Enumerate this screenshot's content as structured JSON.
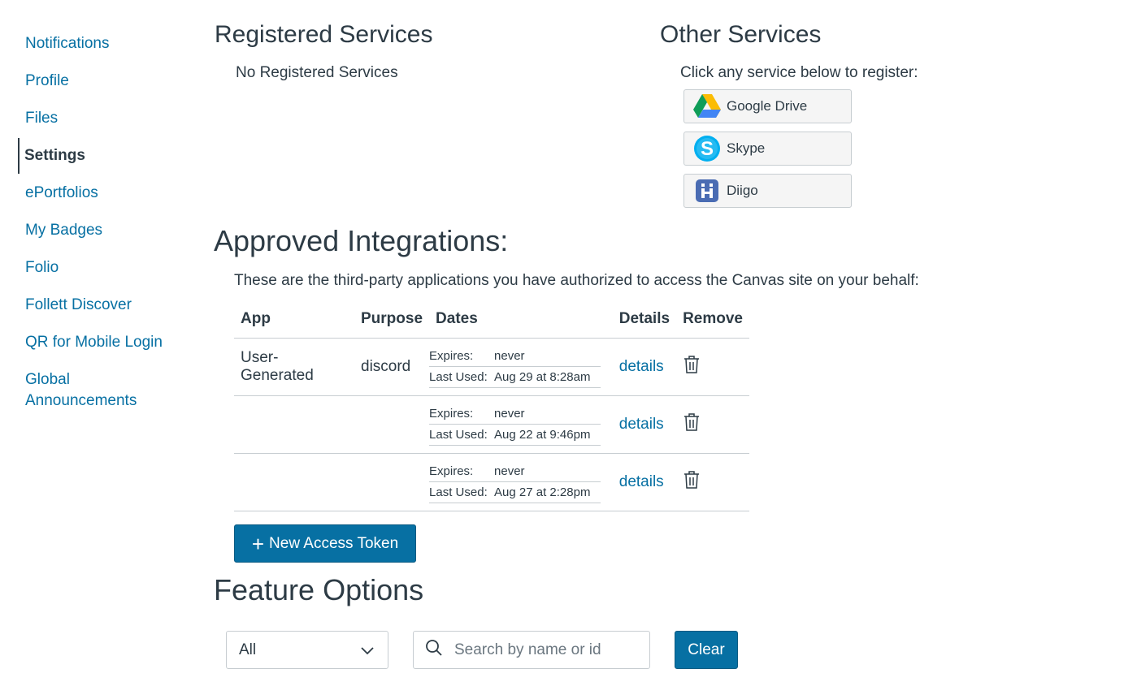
{
  "sidebar": {
    "items": [
      {
        "label": "Notifications"
      },
      {
        "label": "Profile"
      },
      {
        "label": "Files"
      },
      {
        "label": "Settings"
      },
      {
        "label": "ePortfolios"
      },
      {
        "label": "My Badges"
      },
      {
        "label": "Folio"
      },
      {
        "label": "Follett Discover"
      },
      {
        "label": "QR for Mobile Login"
      },
      {
        "label": "Global Announcements"
      }
    ],
    "active": "Settings"
  },
  "registered_services": {
    "title": "Registered Services",
    "empty_text": "No Registered Services"
  },
  "other_services": {
    "title": "Other Services",
    "prompt": "Click any service below to register:",
    "services": [
      {
        "label": "Google Drive",
        "icon": "google-drive-icon"
      },
      {
        "label": "Skype",
        "icon": "skype-icon"
      },
      {
        "label": "Diigo",
        "icon": "diigo-icon"
      }
    ]
  },
  "integrations": {
    "title": "Approved Integrations:",
    "description": "These are the third-party applications you have authorized to access the Canvas site on your behalf:",
    "columns": [
      "App",
      "Purpose",
      "Dates",
      "Details",
      "Remove"
    ],
    "rows": [
      {
        "app": "User-Generated",
        "purpose": "discord",
        "expires_label": "Expires:",
        "expires": "never",
        "last_used_label": "Last Used:",
        "last_used": "Aug 29 at 8:28am",
        "details": "details"
      },
      {
        "app": "",
        "purpose": "",
        "expires_label": "Expires:",
        "expires": "never",
        "last_used_label": "Last Used:",
        "last_used": "Aug 22 at 9:46pm",
        "details": "details"
      },
      {
        "app": "",
        "purpose": "",
        "expires_label": "Expires:",
        "expires": "never",
        "last_used_label": "Last Used:",
        "last_used": "Aug 27 at 2:28pm",
        "details": "details"
      }
    ],
    "new_token_label": "New Access Token"
  },
  "feature_options": {
    "title": "Feature Options",
    "filter_value": "All",
    "search_placeholder": "Search by name or id",
    "clear_label": "Clear"
  },
  "colors": {
    "link": "#0770a3",
    "primary_button": "#0770a3",
    "text": "#2d3b45",
    "border": "#c7cdd1"
  }
}
